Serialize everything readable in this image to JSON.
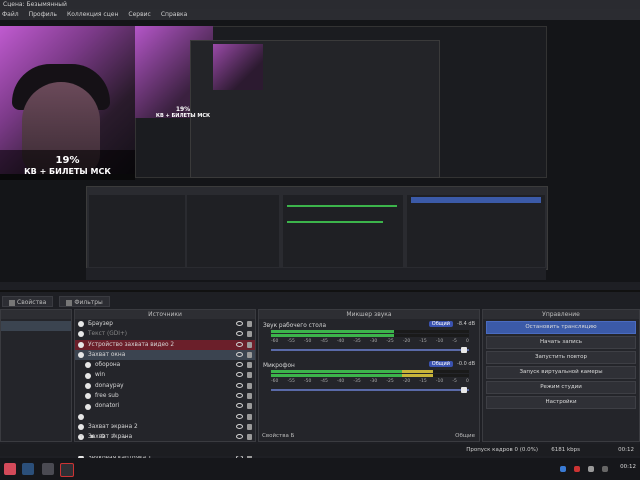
{
  "window": {
    "title": "Сцена: Безымянный"
  },
  "menu": [
    "Файл",
    "Профиль",
    "Коллекция сцен",
    "Сервис",
    "Справка"
  ],
  "preview": {
    "overlay_percent": "19%",
    "overlay_text": "КВ + БИЛЕТЫ МСК",
    "nested_percent": "19%",
    "nested_text": "КВ + БИЛЕТЫ МСК"
  },
  "tabs": [
    {
      "label": "Свойства"
    },
    {
      "label": "Фильтры"
    }
  ],
  "docks": {
    "scenes_title": "",
    "sources_title": "Источники",
    "mixer_title": "Микшер звука",
    "controls_title": "Управление"
  },
  "sources": [
    {
      "label": "Браузер",
      "state": ""
    },
    {
      "label": "Текст (GDI+)",
      "state": "dim"
    },
    {
      "label": "Устройство захвата видео 2",
      "state": "sel"
    },
    {
      "label": "Захват окна",
      "state": "hl"
    },
    {
      "label": "оборона",
      "state": "indent"
    },
    {
      "label": "win",
      "state": "indent"
    },
    {
      "label": "donaypay",
      "state": "indent"
    },
    {
      "label": "free sub",
      "state": "indent"
    },
    {
      "label": "donatori",
      "state": "indent"
    },
    {
      "label": "",
      "state": ""
    },
    {
      "label": "Захват экрана 2",
      "state": ""
    },
    {
      "label": "Захват экрана",
      "state": ""
    },
    {
      "label": "cs2",
      "state": ""
    },
    {
      "label": "Звуковая карточка 1",
      "state": ""
    }
  ],
  "mixer": {
    "channels": [
      {
        "name": "Звук рабочего стола",
        "badge": "Общий",
        "db": "-8.4 dB",
        "level": 0.62
      },
      {
        "name": "Микрофон",
        "badge": "Общий",
        "db": "-0.0 dB",
        "level": 0.82
      }
    ],
    "ticks": [
      "-60",
      "-55",
      "-50",
      "-45",
      "-40",
      "-35",
      "-30",
      "-25",
      "-20",
      "-15",
      "-10",
      "-5",
      "0"
    ],
    "footer": "Свойства Б",
    "mode": "Общие"
  },
  "controls": [
    {
      "label": "Остановить трансляцию",
      "primary": true
    },
    {
      "label": "Начать запись",
      "primary": false
    },
    {
      "label": "Запустить повтор",
      "primary": false
    },
    {
      "label": "Запуск виртуальной камеры",
      "primary": false
    },
    {
      "label": "Режим студии",
      "primary": false
    },
    {
      "label": "Настройки",
      "primary": false
    }
  ],
  "statusbar": {
    "dropped": "Пропуск кадров 0 (0.0%)",
    "bitrate": "6181 kbps",
    "time": "00:12"
  },
  "colors": {
    "accent": "#3b5aa8",
    "selected": "#6b1f2a",
    "bg": "#1e1f24"
  }
}
